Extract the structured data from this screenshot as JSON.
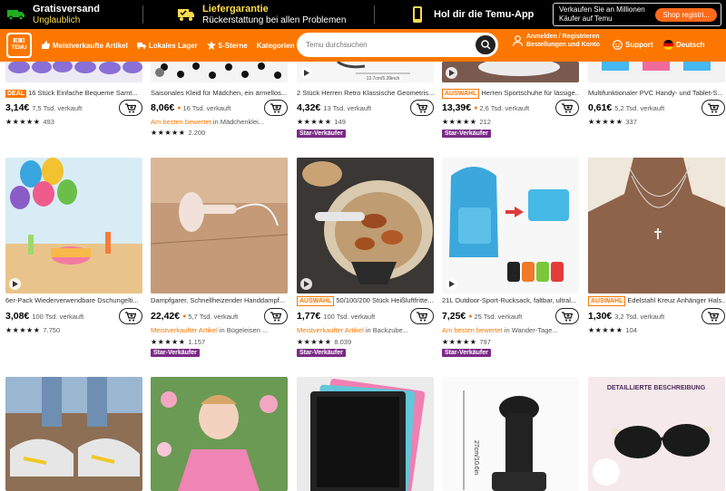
{
  "promo": {
    "free_shipping_title": "Gratisversand",
    "free_shipping_sub": "Unglaublich",
    "delivery_title": "Liefergarantie",
    "delivery_sub": "Rückerstattung bei allen Problemen",
    "app_title": "Hol dir die Temu-App",
    "app_box_text": "Verkaufen Sie an Millionen Käufer auf Temu",
    "app_box_button": "Shop registri..."
  },
  "header": {
    "logo_text": "TEMU",
    "nav": [
      "Meistverkaufte Artikel",
      "Lokales Lager",
      "5-Sterne",
      "Kategorien"
    ],
    "search_placeholder": "Temu durchsuchen",
    "account_line1": "Anmelden / Registrieren",
    "account_line2": "Bestellungen und Konto",
    "support": "Support",
    "language": "Deutsch",
    "accent_color": "#fb7701"
  },
  "rows": [
    {
      "products": [
        {
          "tag": "DEAL",
          "title": "16 Stück Einfache Bequeme Samt...",
          "price": "3,14€",
          "sold": "7,5 Tsd. verkauft",
          "flame": false,
          "rating_count": "493",
          "badge_highlight": "",
          "badge_rest": "",
          "star_seller": ""
        },
        {
          "tag": "",
          "title": "Saisonales Kleid für Mädchen, ein ärmellos...",
          "price": "8,06€",
          "sold": "16 Tsd. verkauft",
          "flame": true,
          "rating_count": "2.200",
          "badge_highlight": "Am besten bewertet",
          "badge_rest": " in Mädchenklei...",
          "star_seller": ""
        },
        {
          "tag": "",
          "title": "2 Stück Herren Retro Klassische Geometris...",
          "price": "4,32€",
          "sold": "13 Tsd. verkauft",
          "flame": false,
          "rating_count": "149",
          "badge_highlight": "",
          "badge_rest": "",
          "star_seller": "Star-Verkäufer"
        },
        {
          "tag": "AUSWAHL",
          "title": "Herren Sportschuhe für lässige...",
          "price": "13,39€",
          "sold": "2,6 Tsd. verkauft",
          "flame": true,
          "rating_count": "212",
          "badge_highlight": "",
          "badge_rest": "",
          "star_seller": "Star-Verkäufer"
        },
        {
          "tag": "",
          "title": "Multifunktionaler PVC Handy- und Tablet-S...",
          "price": "0,61€",
          "sold": "5,2 Tsd. verkauft",
          "flame": false,
          "rating_count": "337",
          "badge_highlight": "",
          "badge_rest": "",
          "star_seller": ""
        }
      ]
    },
    {
      "products": [
        {
          "tag": "",
          "title": "6er-Pack Wiederverwendbare Dschungelti...",
          "price": "3,08€",
          "sold": "100 Tsd. verkauft",
          "flame": false,
          "rating_count": "7.750",
          "badge_highlight": "",
          "badge_rest": "",
          "star_seller": ""
        },
        {
          "tag": "",
          "title": "Dampfgarer, Schnellheizender Handdampf...",
          "price": "22,42€",
          "sold": "5,7 Tsd. verkauft",
          "flame": true,
          "rating_count": "1.157",
          "badge_highlight": "Meistverkaufter Artikel",
          "badge_rest": " in Bügeleisen ...",
          "star_seller": "Star-Verkäufer"
        },
        {
          "tag": "AUSWAHL",
          "title": "50/100/200 Stück Heißluftfritte...",
          "price": "1,77€",
          "sold": "100 Tsd. verkauft",
          "flame": false,
          "rating_count": "8.039",
          "badge_highlight": "Meistverkaufter Artikel",
          "badge_rest": " in Backzube...",
          "star_seller": "Star-Verkäufer"
        },
        {
          "tag": "",
          "title": "21L Outdoor-Sport-Rucksack, faltbar, ultral...",
          "price": "7,25€",
          "sold": "25 Tsd. verkauft",
          "flame": true,
          "rating_count": "797",
          "badge_highlight": "Am besten bewertet",
          "badge_rest": " in Wander-Tage...",
          "star_seller": "Star-Verkäufer"
        },
        {
          "tag": "AUSWAHL",
          "title": "Edelstahl Kreuz Anhänger Hals...",
          "price": "1,30€",
          "sold": "3,2 Tsd. verkauft",
          "flame": false,
          "rating_count": "104",
          "badge_highlight": "",
          "badge_rest": "",
          "star_seller": ""
        }
      ]
    },
    {
      "products": [
        {
          "image_label": ""
        },
        {
          "image_label": ""
        },
        {
          "image_label": ""
        },
        {
          "image_label": "27cm/10.6in"
        },
        {
          "image_label": "DETAILLIERTE BESCHREIBUNG"
        }
      ]
    }
  ],
  "top_image_label": "13.7cm/5.39inch"
}
